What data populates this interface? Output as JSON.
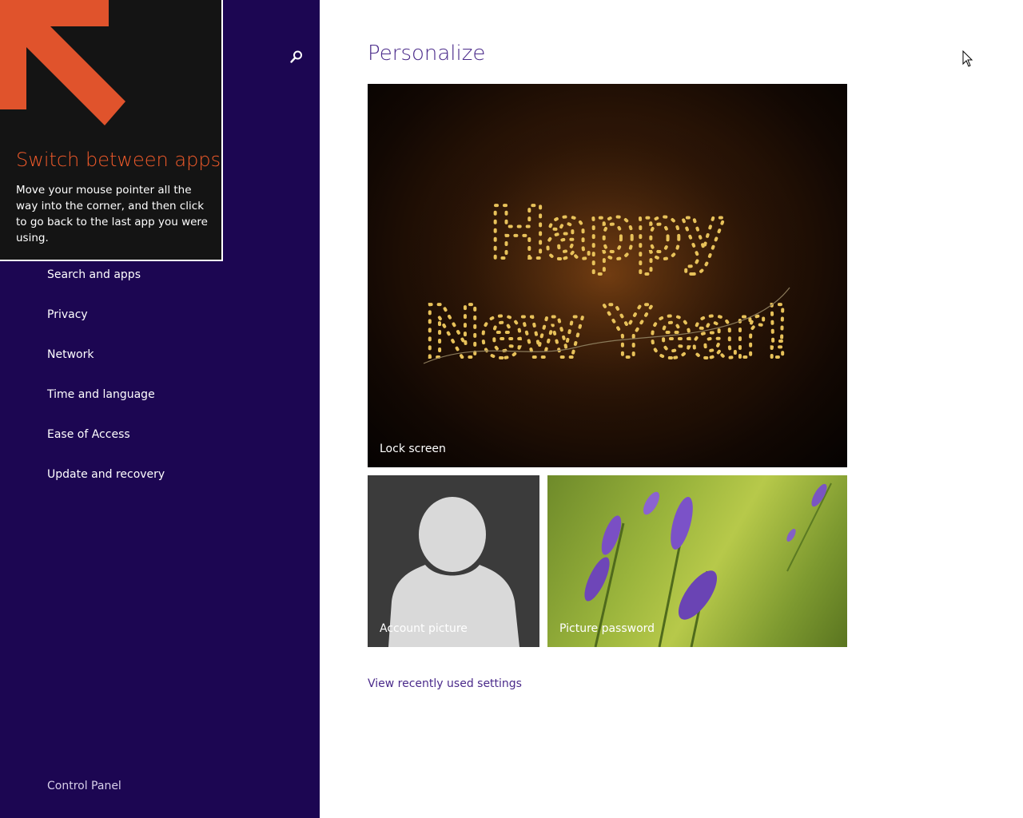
{
  "sidebar": {
    "search_icon": "search-icon",
    "items": [
      {
        "label": "Search and apps"
      },
      {
        "label": "Privacy"
      },
      {
        "label": "Network"
      },
      {
        "label": "Time and language"
      },
      {
        "label": "Ease of Access"
      },
      {
        "label": "Update and recovery"
      }
    ],
    "footer_link": "Control Panel",
    "background": "#1c0652"
  },
  "tip": {
    "title": "Switch between apps",
    "body": "Move your mouse pointer all the way into the corner, and then click to go back to the last app you were using.",
    "arrow_color": "#e0532c"
  },
  "main": {
    "title": "Personalize",
    "tiles": {
      "lock_screen": {
        "label": "Lock screen",
        "image_text_line1": "Happy",
        "image_text_line2": "New Year!"
      },
      "account_picture": {
        "label": "Account picture"
      },
      "picture_password": {
        "label": "Picture password"
      }
    },
    "recent_link": "View recently used settings",
    "accent": "#4a2a8a"
  }
}
